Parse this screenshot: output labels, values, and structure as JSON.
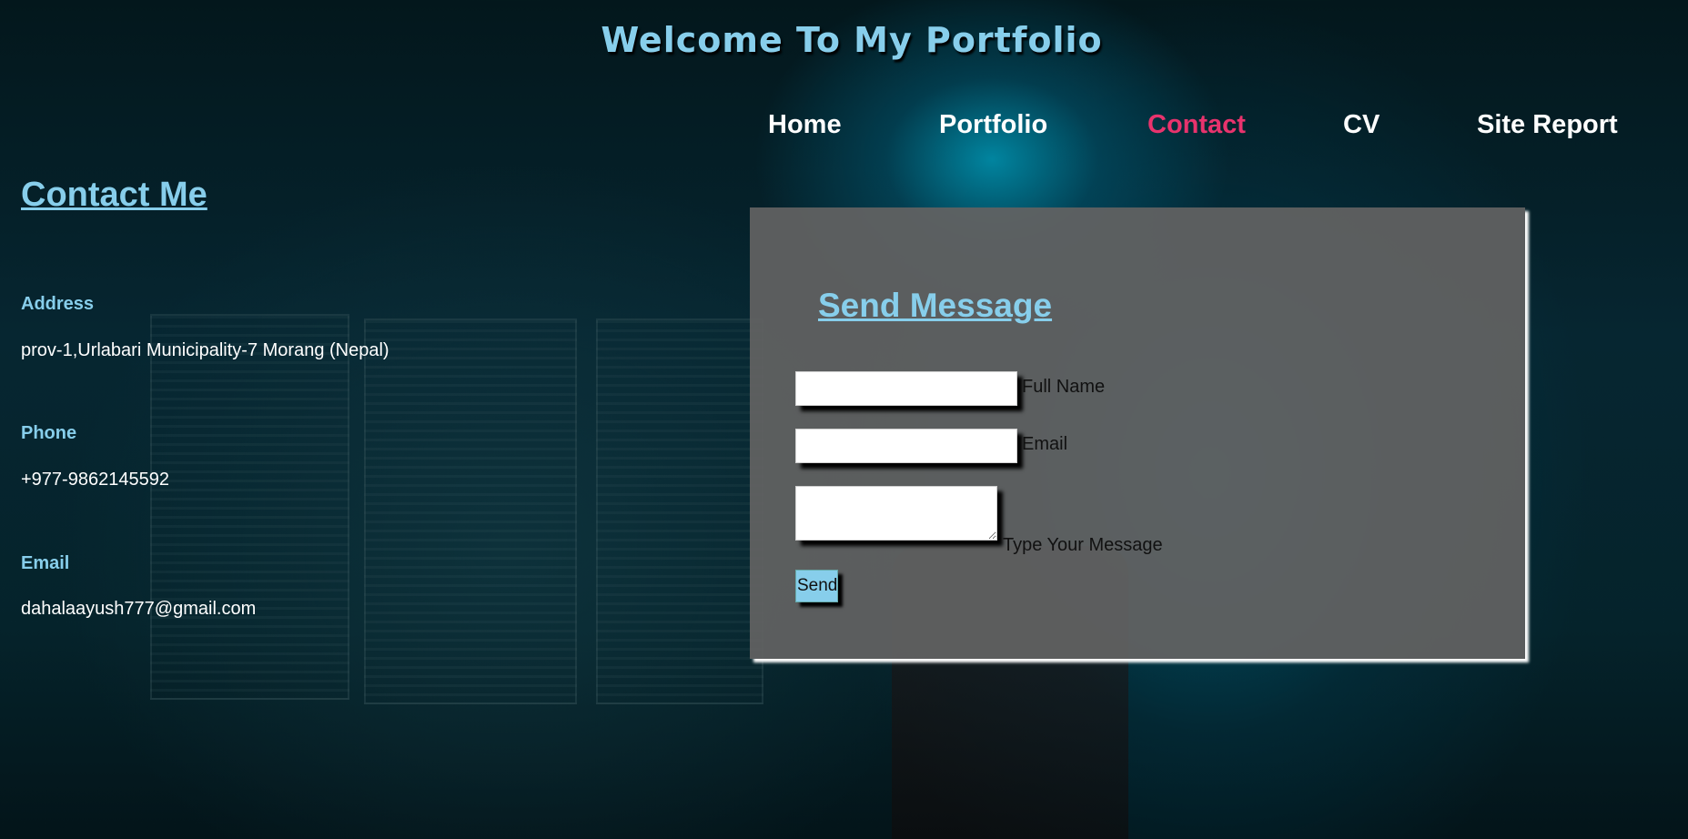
{
  "header": {
    "title": "Welcome To My Portfolio"
  },
  "nav": {
    "items": [
      {
        "label": "Home"
      },
      {
        "label": "Portfolio"
      },
      {
        "label": "Contact",
        "active": true
      },
      {
        "label": "CV"
      },
      {
        "label": "Site Report"
      }
    ],
    "active_color": "#e8336d"
  },
  "contact": {
    "heading": "Contact Me",
    "address_label": "Address",
    "address_value": "prov-1,Urlabari Municipality-7 Morang (Nepal)",
    "phone_label": "Phone",
    "phone_value": "+977-9862145592",
    "email_label": "Email",
    "email_value": "dahalaayush777@gmail.com"
  },
  "form": {
    "heading": "Send Message",
    "full_name_label": "Full Name",
    "full_name_value": "",
    "email_label": "Email",
    "email_value": "",
    "message_label": "Type Your Message",
    "message_value": "",
    "send_label": "Send"
  },
  "colors": {
    "accent": "#87ceeb",
    "panel": "#626262"
  }
}
